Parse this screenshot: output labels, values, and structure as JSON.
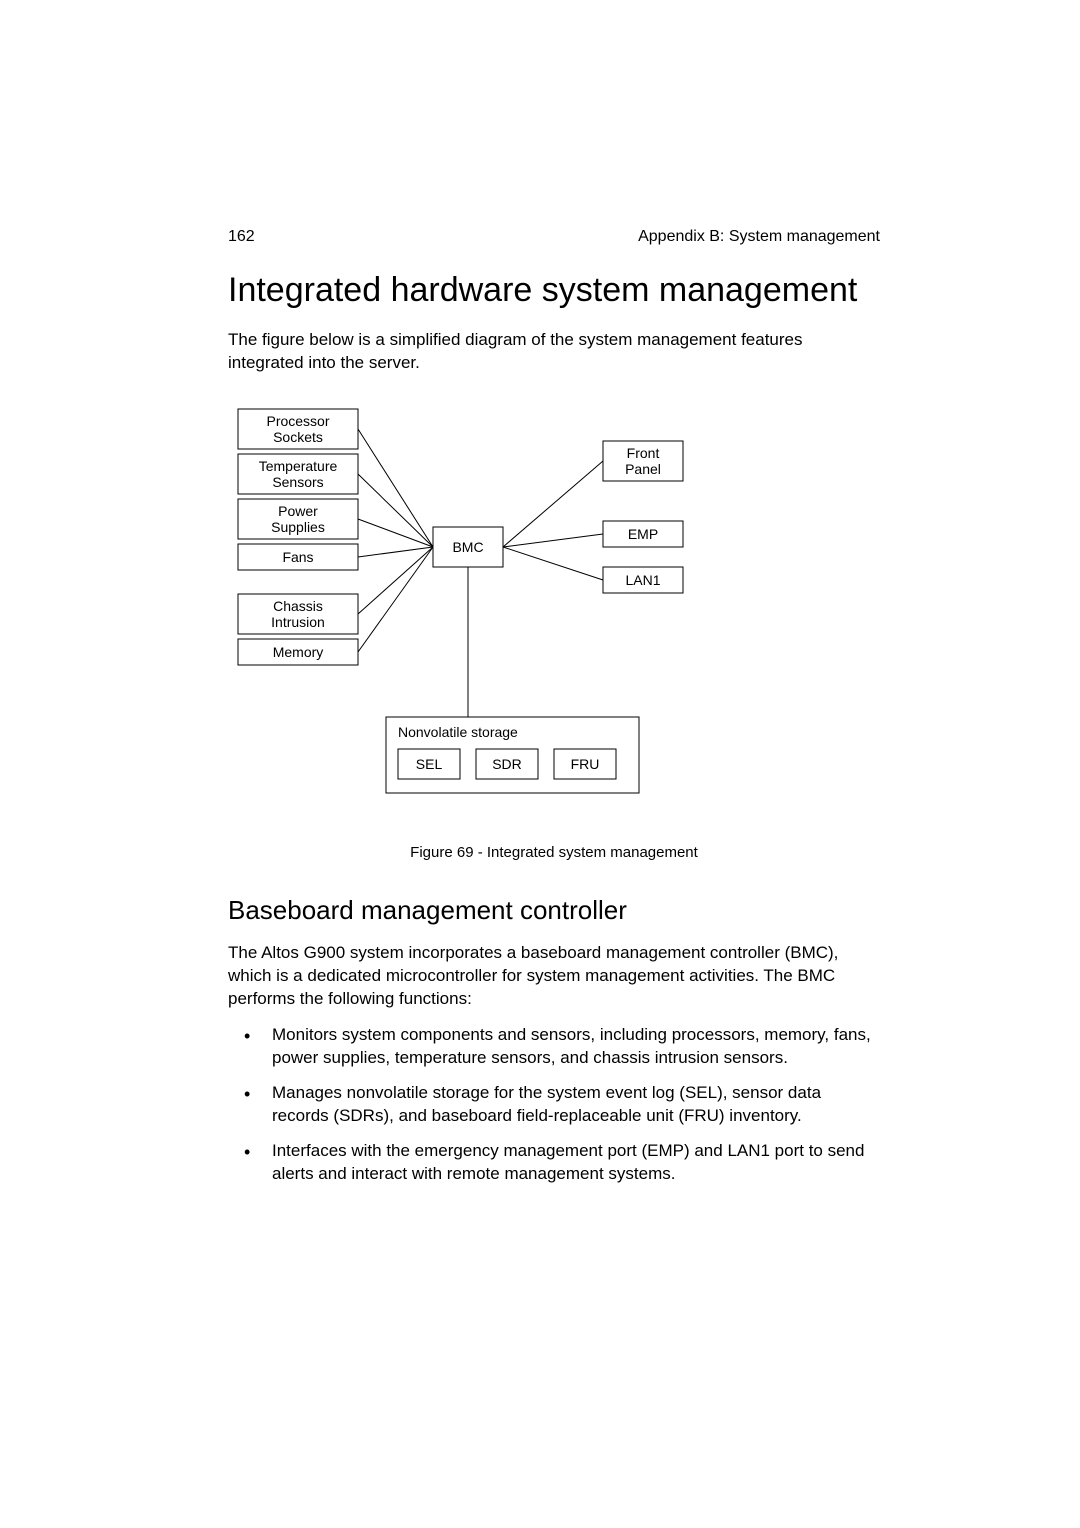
{
  "header": {
    "page_number": "162",
    "section": "Appendix B: System management"
  },
  "title": "Integrated hardware system management",
  "intro": "The figure below is a simplified diagram of the system management features integrated into the server.",
  "diagram": {
    "left_boxes": [
      "Processor Sockets",
      "Temperature Sensors",
      "Power Supplies",
      "Fans",
      "Chassis Intrusion",
      "Memory"
    ],
    "center_box": "BMC",
    "right_boxes": [
      "Front Panel",
      "EMP",
      "LAN1"
    ],
    "storage_label": "Nonvolatile storage",
    "storage_boxes": [
      "SEL",
      "SDR",
      "FRU"
    ]
  },
  "caption": "Figure 69 - Integrated system management",
  "subheading": "Baseboard management controller",
  "paragraph": "The Altos G900 system incorporates a baseboard management controller (BMC), which is a dedicated microcontroller for system management activities.  The BMC performs the following functions:",
  "bullets": [
    "Monitors system components and sensors, including processors, memory, fans, power supplies, temperature sensors, and chassis intrusion sensors.",
    "Manages nonvolatile storage for the system event log (SEL), sensor data records (SDRs), and baseboard field-replaceable unit (FRU) inventory.",
    "Interfaces with the emergency management port (EMP) and LAN1 port to send alerts and interact with remote management systems."
  ]
}
